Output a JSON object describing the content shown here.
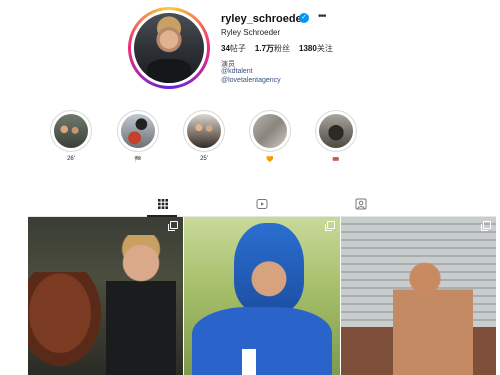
{
  "profile": {
    "username": "ryley_schroeder",
    "verified_icon": "verified-badge-icon",
    "more_icon": "more-options-icon",
    "full_name": "Ryley Schroeder",
    "stats": {
      "posts_value": "34",
      "posts_label": "帖子",
      "followers_value": "1.7万",
      "followers_label": "粉丝",
      "following_value": "1380",
      "following_label": "关注"
    },
    "bio": {
      "category": "演员",
      "link1": "@kdtalent",
      "link2": "@lovetalentagency"
    },
    "colors": {
      "link": "#385185",
      "verified": "#0095f6"
    }
  },
  "highlights": [
    {
      "label": "26'"
    },
    {
      "label": "🏁"
    },
    {
      "label": "25'"
    },
    {
      "label": "🧡"
    },
    {
      "label": "🎟️"
    }
  ],
  "tabs": [
    {
      "icon": "grid-icon",
      "active": true
    },
    {
      "icon": "reels-icon",
      "active": false
    },
    {
      "icon": "tagged-icon",
      "active": false
    }
  ],
  "posts": [
    {
      "type": "carousel",
      "icon": "multiple-images-icon"
    },
    {
      "type": "carousel",
      "icon": "multiple-images-icon"
    },
    {
      "type": "carousel",
      "icon": "multiple-images-icon"
    }
  ]
}
